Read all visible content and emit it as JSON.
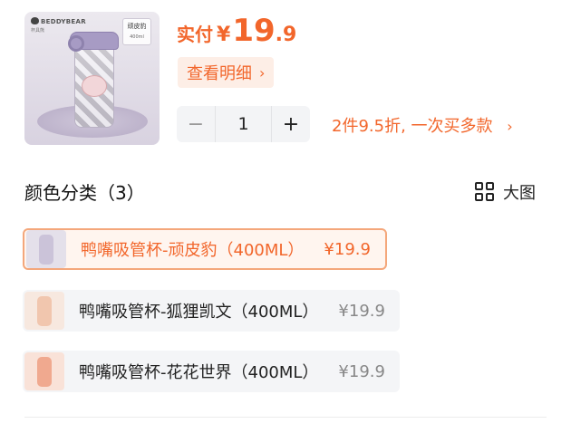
{
  "product": {
    "brand": "BEDDYBEAR",
    "brand_sub": "杯具熊",
    "variant_tag": "顽皮豹",
    "capacity_tag": "400ml"
  },
  "price": {
    "label": "实付",
    "currency": "¥",
    "integer": "19",
    "decimal": ".9"
  },
  "detail_button": {
    "label": "查看明细",
    "chevron": "›"
  },
  "quantity": {
    "minus": "−",
    "value": "1",
    "plus": "+"
  },
  "promo": {
    "text": "2件9.5折, 一次买多款",
    "chevron": "›"
  },
  "color_section": {
    "title": "颜色分类（3）",
    "large_view_label": "大图",
    "options": [
      {
        "name": "鸭嘴吸管杯-顽皮豹（400ML）",
        "price": "¥19.9",
        "selected": true,
        "thumb_color": "#cbc3d9"
      },
      {
        "name": "鸭嘴吸管杯-狐狸凯文（400ML）",
        "price": "¥19.9",
        "selected": false,
        "thumb_color": "#f1c6ae"
      },
      {
        "name": "鸭嘴吸管杯-花花世界（400ML）",
        "price": "¥19.9",
        "selected": false,
        "thumb_color": "#f0a98f"
      }
    ]
  },
  "colors": {
    "accent": "#f2662b",
    "accent_bg": "#fdeee6",
    "selected_border": "#f4a77b",
    "option_bg": "#f4f5f7"
  }
}
